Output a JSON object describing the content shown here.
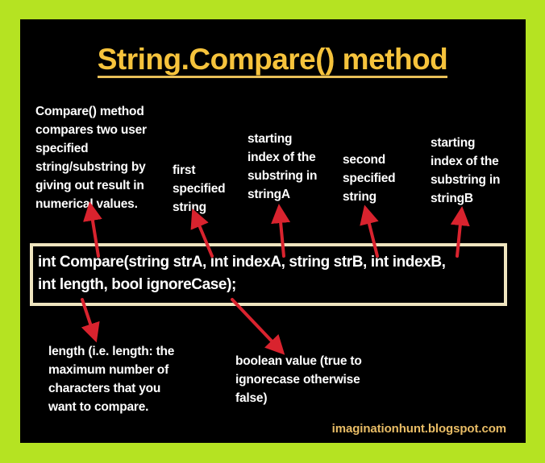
{
  "title": "String.Compare() method",
  "colors": {
    "background": "#b5e322",
    "panel": "#000000",
    "title": "#f6c33c",
    "text": "#ffffff",
    "box_border": "#efe5bf",
    "arrow": "#d9232e",
    "credit": "#e9bd66"
  },
  "annotations": {
    "description": "Compare() method\ncompares two user\nspecified\nstring/substring by\ngiving out result in\nnumerical values.",
    "strA": "first\nspecified\nstring",
    "indexA": "starting\nindex of the\nsubstring in\nstringA",
    "strB": "second\nspecified\nstring",
    "indexB": "starting\nindex of the\nsubstring in\nstringB",
    "length": "length (i.e. length: the\nmaximum number of\ncharacters that you\nwant to compare.",
    "ignoreCase": "boolean value (true to\nignorecase otherwise\nfalse)"
  },
  "signature": "int Compare(string strA, int indexA, string strB, int indexB,\nint length, bool ignoreCase);",
  "credit": "imaginationhunt.blogspot.com"
}
